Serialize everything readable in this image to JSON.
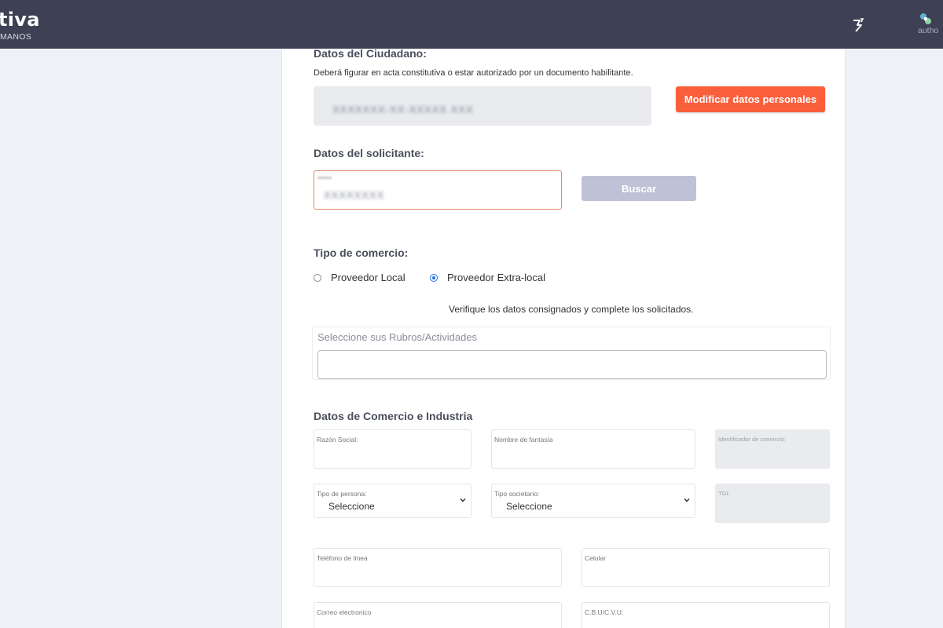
{
  "header": {
    "brand_title": "tiva",
    "brand_subtitle": "MANOS",
    "user_name": "autho",
    "icons": {
      "notifications": "notification-icon",
      "avatar": "user-avatar-icon"
    }
  },
  "colors": {
    "header_bg": "#3e4154",
    "accent_orange": "#fa5f3c",
    "disabled_button": "#bfc2d6",
    "radio_checked": "#1a73e8"
  },
  "citizen": {
    "section_label": "Datos del Ciudadano:",
    "note": "Deberá figurar en acta constitutiva o estar autorizado por un documento habilitante.",
    "redacted_value": "XXXXXXX-XX-XXXXX XXX",
    "modify_button": "Modificar datos personales"
  },
  "applicant": {
    "section_label": "Datos del solicitante:",
    "redacted_value": "XXXXXXXX",
    "search_button": "Buscar"
  },
  "commerce_type": {
    "section_label": "Tipo de comercio:",
    "options": [
      {
        "label": "Proveedor Local",
        "selected": false
      },
      {
        "label": "Proveedor Extra-local",
        "selected": true
      }
    ]
  },
  "verify_text": "Verifique los datos consignados y complete los solicitados.",
  "rubros": {
    "label": "Seleccione sus Rubros/Actividades",
    "value": ""
  },
  "business": {
    "section_label": "Datos de Comercio e Industria",
    "razon_social": {
      "label": "Razón Social:",
      "value": ""
    },
    "nombre_fantasia": {
      "label": "Nombre de fantasía",
      "value": ""
    },
    "identificador": {
      "label": "Identificador de comercio:",
      "value": ""
    },
    "tipo_persona": {
      "label": "Tipo de persona:",
      "value": "Seleccione"
    },
    "tipo_societario": {
      "label": "Tipo societario:",
      "value": "Seleccione"
    },
    "tgi": {
      "label": "TGI:",
      "value": ""
    },
    "telefono": {
      "label": "Teléfono de línea",
      "value": ""
    },
    "celular": {
      "label": "Celular",
      "value": ""
    },
    "correo": {
      "label": "Correo electronico",
      "value": ""
    },
    "cbu": {
      "label": "C.B.U/C.V.U:",
      "value": ""
    }
  }
}
